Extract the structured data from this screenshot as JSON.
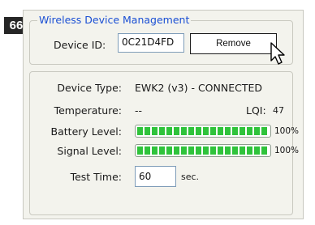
{
  "step_number": "66",
  "group": {
    "title": "Wireless Device Management",
    "device_id_label": "Device ID:",
    "device_id_value": "0C21D4FD",
    "remove_button": "Remove"
  },
  "status": {
    "device_type_label": "Device Type:",
    "device_type_value": "EWK2 (v3) - CONNECTED",
    "temperature_label": "Temperature:",
    "temperature_value": "--",
    "lqi_label": "LQI:",
    "lqi_value": "47",
    "battery_label": "Battery Level:",
    "battery_level": 1.0,
    "battery_pct": "100%",
    "signal_label": "Signal Level:",
    "signal_level": 1.0,
    "signal_pct": "100%",
    "test_time_label": "Test Time:",
    "test_time_value": "60",
    "test_time_unit": "sec."
  },
  "colors": {
    "group_title": "#1a4fd4",
    "bar_fill": "#2fc33b",
    "badge_bg": "#262626"
  }
}
